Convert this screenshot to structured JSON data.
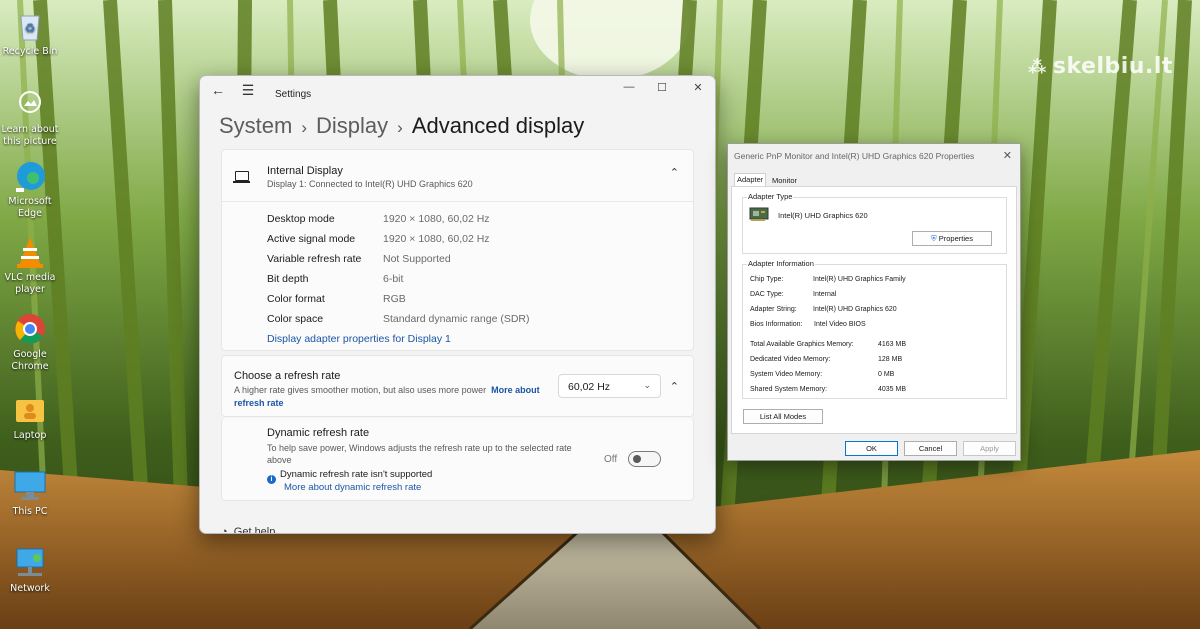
{
  "watermark": "skelbiu.lt",
  "desktop_icons": [
    {
      "label": "Recycle Bin"
    },
    {
      "label": "Learn about this picture"
    },
    {
      "label": "Microsoft Edge"
    },
    {
      "label": "VLC media player"
    },
    {
      "label": "Google Chrome"
    },
    {
      "label": "Laptop"
    },
    {
      "label": "This PC"
    },
    {
      "label": "Network"
    }
  ],
  "settings": {
    "app_title": "Settings",
    "back_glyph": "←",
    "menu_glyph": "☰",
    "window_controls": {
      "minimize": "—",
      "maximize": "☐",
      "close": "✕"
    },
    "breadcrumb": {
      "system": "System",
      "display": "Display",
      "current": "Advanced display",
      "separator": "›"
    },
    "display_card": {
      "title": "Internal Display",
      "subtitle": "Display 1: Connected to Intel(R) UHD Graphics 620",
      "chevron": "⌃",
      "rows": [
        {
          "label": "Desktop mode",
          "value": "1920 × 1080, 60,02 Hz"
        },
        {
          "label": "Active signal mode",
          "value": "1920 × 1080, 60,02 Hz"
        },
        {
          "label": "Variable refresh rate",
          "value": "Not Supported"
        },
        {
          "label": "Bit depth",
          "value": "6-bit"
        },
        {
          "label": "Color format",
          "value": "RGB"
        },
        {
          "label": "Color space",
          "value": "Standard dynamic range (SDR)"
        }
      ],
      "adapter_link": "Display adapter properties for Display 1"
    },
    "refresh_card": {
      "title": "Choose a refresh rate",
      "subtitle": "A higher rate gives smoother motion, but also uses more power",
      "more_link": "More about refresh rate",
      "selected_rate": "60,02 Hz",
      "dropdown_chevron": "⌄",
      "chevron": "⌃"
    },
    "dynamic_card": {
      "title": "Dynamic refresh rate",
      "description": "To help save power, Windows adjusts the refresh rate up to the selected rate above",
      "toggle_label": "Off",
      "toggle_on": false,
      "info_text": "Dynamic refresh rate isn't supported",
      "info_link": "More about dynamic refresh rate"
    },
    "cutoff_text": "Get help"
  },
  "properties_dialog": {
    "title": "Generic PnP Monitor and Intel(R) UHD Graphics 620 Properties",
    "close": "✕",
    "tabs": [
      {
        "label": "Adapter",
        "active": true
      },
      {
        "label": "Monitor",
        "active": false
      }
    ],
    "adapter_type": {
      "group_label": "Adapter Type",
      "name": "Intel(R) UHD Graphics 620",
      "properties_button": "Properties"
    },
    "adapter_info": {
      "group_label": "Adapter Information",
      "rows": [
        {
          "key": "Chip Type:",
          "value": "Intel(R) UHD Graphics Family"
        },
        {
          "key": "DAC Type:",
          "value": "Internal"
        },
        {
          "key": "Adapter String:",
          "value": "Intel(R) UHD Graphics 620"
        },
        {
          "key": "Bios Information:",
          "value": "Intel Video BIOS"
        }
      ],
      "memory_rows": [
        {
          "key": "Total Available Graphics Memory:",
          "value": "4163 MB"
        },
        {
          "key": "Dedicated Video Memory:",
          "value": "128 MB"
        },
        {
          "key": "System Video Memory:",
          "value": "0 MB"
        },
        {
          "key": "Shared System Memory:",
          "value": "4035 MB"
        }
      ]
    },
    "list_all_modes": "List All Modes",
    "buttons": {
      "ok": "OK",
      "cancel": "Cancel",
      "apply": "Apply"
    }
  }
}
